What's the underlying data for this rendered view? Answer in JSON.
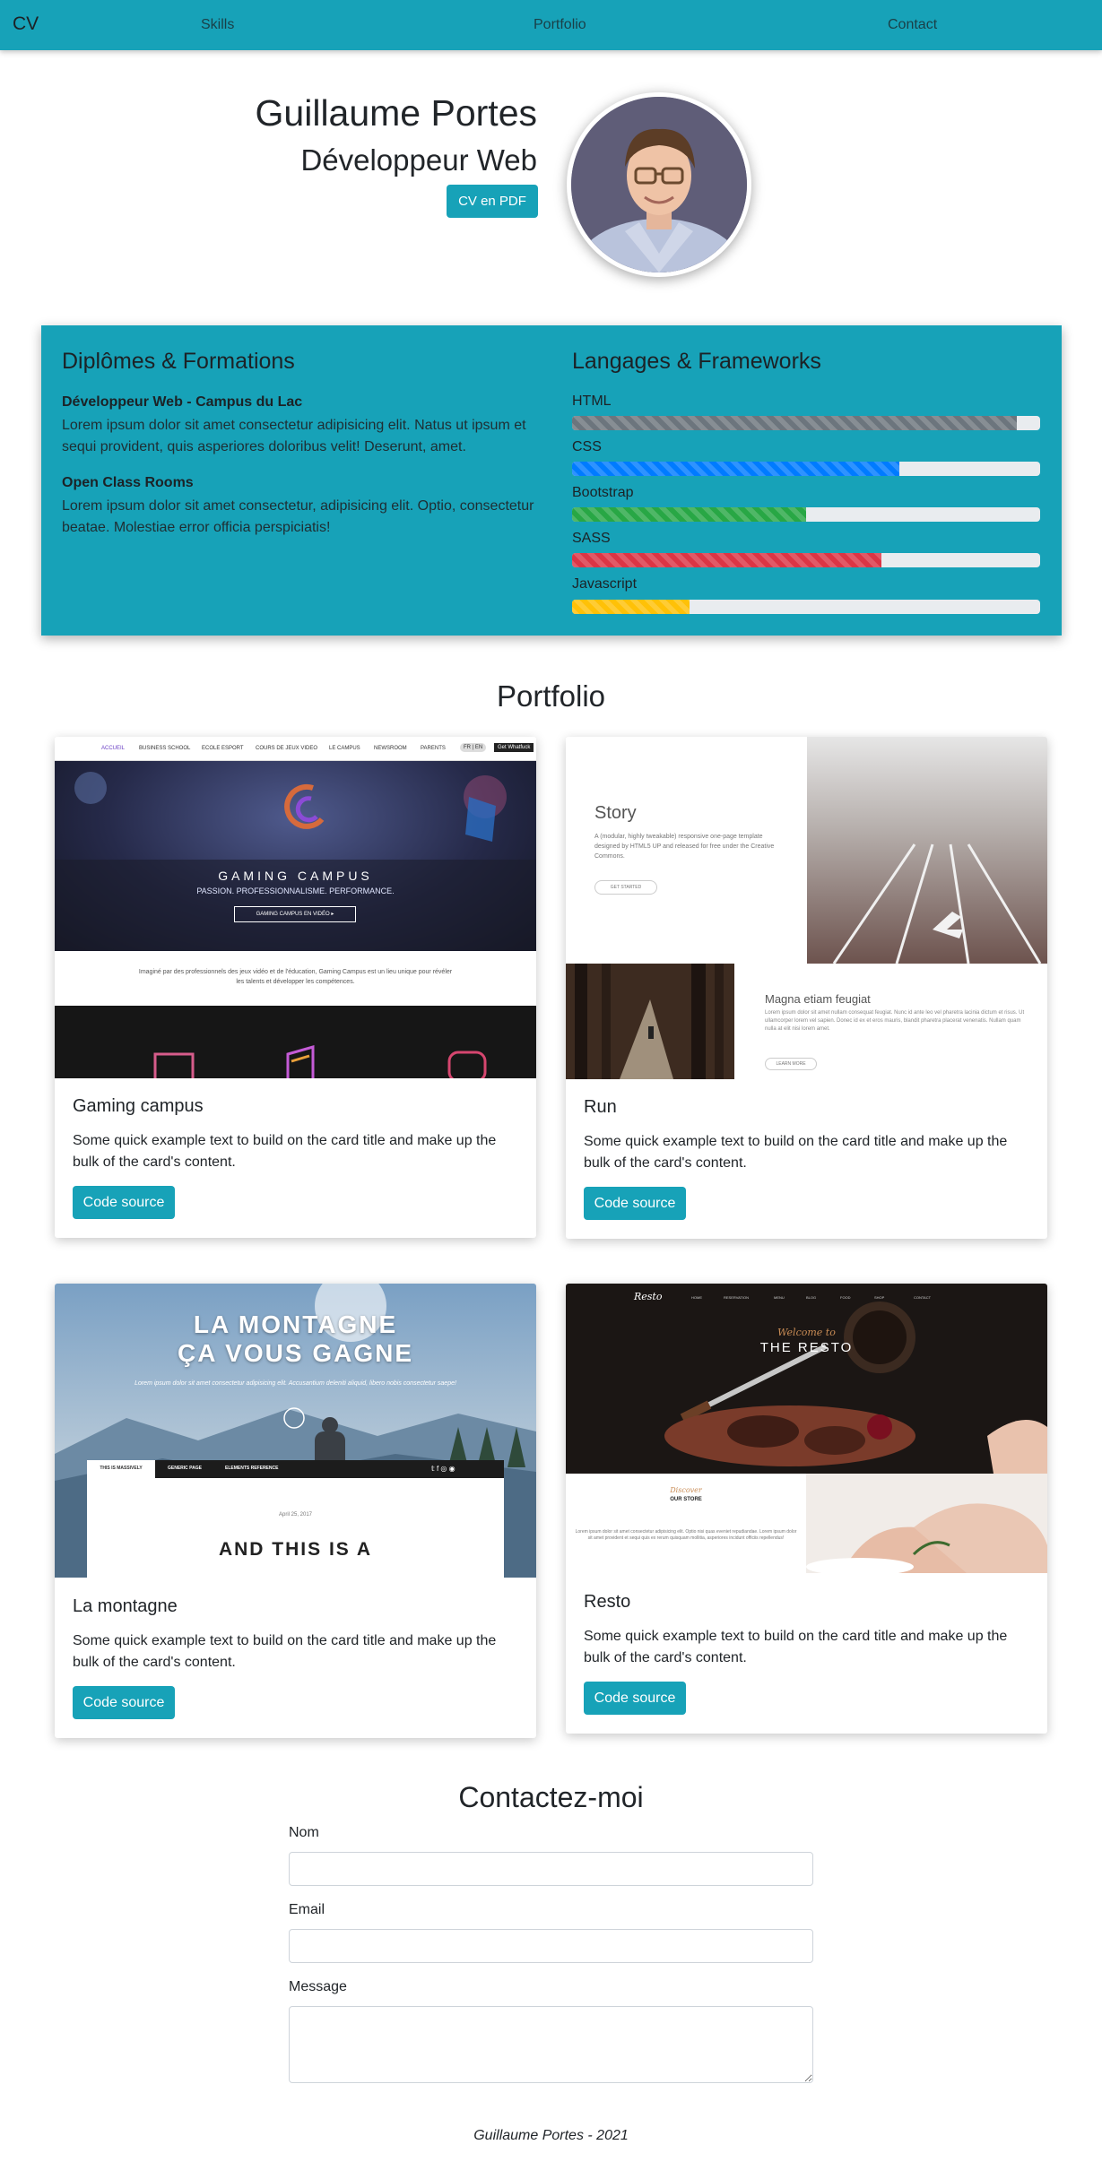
{
  "navbar": {
    "brand": "CV",
    "links": [
      "Skills",
      "Portfolio",
      "Contact"
    ]
  },
  "header": {
    "name": "Guillaume Portes",
    "role": "Développeur Web",
    "cv_button": "CV en PDF"
  },
  "education": {
    "heading": "Diplômes & Formations",
    "items": [
      {
        "title": "Développeur Web - Campus du Lac",
        "text": "Lorem ipsum dolor sit amet consectetur adipisicing elit. Natus ut ipsum et sequi provident, quis asperiores doloribus velit! Deserunt, amet."
      },
      {
        "title": "Open Class Rooms",
        "text": "Lorem ipsum dolor sit amet consectetur, adipisicing elit. Optio, consectetur beatae. Molestiae error officia perspiciatis!"
      }
    ]
  },
  "skills": {
    "heading": "Langages & Frameworks",
    "items": [
      {
        "label": "HTML",
        "level": 0.95,
        "color": "#6c757d"
      },
      {
        "label": "CSS",
        "level": 0.7,
        "color": "#007bff"
      },
      {
        "label": "Bootstrap",
        "level": 0.5,
        "color": "#28a745"
      },
      {
        "label": "SASS",
        "level": 0.66,
        "color": "#dc3545"
      },
      {
        "label": "Javascript",
        "level": 0.25,
        "color": "#ffc107"
      }
    ]
  },
  "portfolio": {
    "heading": "Portfolio",
    "cards": [
      {
        "title": "Gaming campus",
        "text": "Some quick example text to build on the card title and make up the bulk of the card's content.",
        "button": "Code source"
      },
      {
        "title": "Run",
        "text": "Some quick example text to build on the card title and make up the bulk of the card's content.",
        "button": "Code source"
      },
      {
        "title": "La montagne",
        "text": "Some quick example text to build on the card title and make up the bulk of the card's content.",
        "button": "Code source"
      },
      {
        "title": "Resto",
        "text": "Some quick example text to build on the card title and make up the bulk of the card's content.",
        "button": "Code source"
      }
    ],
    "thumbs": {
      "gaming": {
        "nav": [
          "ACCUEIL",
          "BUSINESS SCHOOL",
          "ECOLE ESPORT",
          "COURS DE JEUX VIDEO",
          "LE CAMPUS",
          "NEWSROOM",
          "PARENTS"
        ],
        "lang": "FR | EN",
        "cta": "Get Whatfuck",
        "headline": "GAMING CAMPUS",
        "tagline": "PASSION. PROFESSIONNALISME. PERFORMANCE.",
        "video_btn": "GAMING CAMPUS EN VIDÉO ▸",
        "blurb": "Imaginé par des professionnels des jeux vidéo et de l'éducation, Gaming Campus est un lieu unique pour révéler les talents et développer les compétences."
      },
      "run": {
        "title": "Story",
        "text": "A (modular, highly tweakable) responsive one-page template designed by HTML5 UP and released for free under the Creative Commons.",
        "btn": "GET STARTED",
        "title2": "Magna etiam feugiat",
        "text2": "Lorem ipsum dolor sit amet nullam consequat feugiat. Nunc id ante leo vel pharetra lacinia dictum et risus. Ut ullamcorper lorem vel sapien. Donec id ex et eros mauris, blandit pharetra placerat venenatis. Nullam quam nulla at elit nisi lorem amet.",
        "btn2": "LEARN MORE"
      },
      "montagne": {
        "headline1": "LA MONTAGNE",
        "headline2": "ÇA VOUS GAGNE",
        "sub": "Lorem ipsum dolor sit amet consectetur adipisicing elit. Accusantium deleniti aliquid, libero nobis consectetur saepe!",
        "tabs": [
          "THIS IS MASSIVELY",
          "GENERIC PAGE",
          "ELEMENTS REFERENCE"
        ],
        "date": "April 25, 2017",
        "article": "AND THIS IS A"
      },
      "resto": {
        "logo": "Resto",
        "nav": [
          "HOME",
          "RESERVATION",
          "MENU",
          "BLOG",
          "FOOD",
          "SHOP",
          "CONTACT"
        ],
        "script": "Welcome to",
        "headline": "THE RESTO",
        "discover": "Discover",
        "store": "OUR STORE",
        "blurb": "Lorem ipsum dolor sit amet consectetur adipisicing elit. Optio nisi quas eveniet repudiandae. Lorem ipsum dolor sit amet provident et sequi quis ex rerum quisquam mollitia, asperiores incidunt officiis repellendus!"
      }
    }
  },
  "contact": {
    "heading": "Contactez-moi",
    "fields": {
      "name": "Nom",
      "email": "Email",
      "message": "Message"
    }
  },
  "footer": "Guillaume Portes - 2021"
}
